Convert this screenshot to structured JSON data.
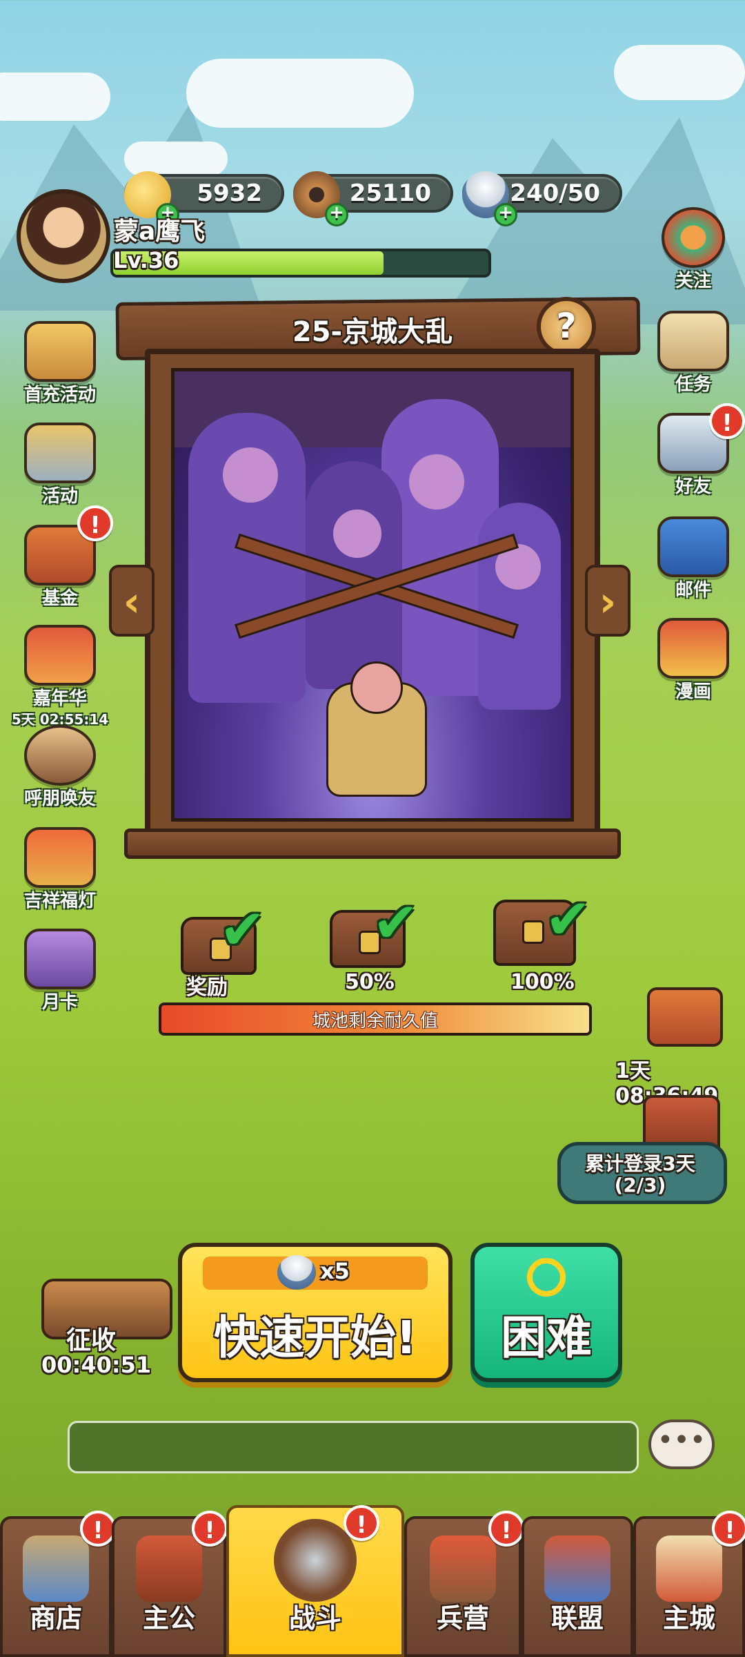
{
  "colors": {
    "accent_yellow": "#ffd21f",
    "hard_green": "#1fbf86",
    "wood": "#7a4a2d",
    "badge_red": "#e23a2a"
  },
  "resources": [
    {
      "icon": "gold-ingot-icon",
      "value": "5932"
    },
    {
      "icon": "coin-icon",
      "value": "25110"
    },
    {
      "icon": "rice-bowl-icon",
      "value": "240/50"
    }
  ],
  "player": {
    "name": "蒙a鹰飞",
    "level": "Lv.36",
    "exp_fraction": 0.72
  },
  "stage": {
    "title": "25-京城大乱",
    "help": "?"
  },
  "left_menu": [
    {
      "label": "首充活动",
      "sub": ""
    },
    {
      "label": "活动",
      "sub": ""
    },
    {
      "label": "基金",
      "sub": ""
    },
    {
      "label": "嘉年华",
      "sub": "5天 02:55:14"
    },
    {
      "label": "呼朋唤友",
      "sub": ""
    },
    {
      "label": "吉祥福灯",
      "sub": ""
    },
    {
      "label": "月卡",
      "sub": ""
    }
  ],
  "right_menu": [
    {
      "label": "关注"
    },
    {
      "label": "任务"
    },
    {
      "label": "好友"
    },
    {
      "label": "邮件"
    },
    {
      "label": "漫画"
    }
  ],
  "rewards": [
    {
      "label": "奖励"
    },
    {
      "label": "50%"
    },
    {
      "label": "100%"
    }
  ],
  "durability": {
    "label": "城池剩余耐久值",
    "fraction": 1.0
  },
  "timed_chest": {
    "timer": "1天 08:36:49"
  },
  "login_bonus": {
    "label": "累计登录3天",
    "progress": "(2/3)"
  },
  "collect": {
    "label": "征收",
    "timer": "00:40:51"
  },
  "quick_start": {
    "cost": "x5",
    "label": "快速开始!"
  },
  "hard_button": {
    "label": "困难"
  },
  "chat": {
    "placeholder": ""
  },
  "nav": [
    {
      "label": "商店",
      "icon": "shop-icon"
    },
    {
      "label": "主公",
      "icon": "lord-icon"
    },
    {
      "label": "战斗",
      "icon": "battle-icon",
      "active": true
    },
    {
      "label": "兵营",
      "icon": "barracks-icon"
    },
    {
      "label": "联盟",
      "icon": "alliance-icon"
    },
    {
      "label": "主城",
      "icon": "main-city-icon"
    }
  ]
}
